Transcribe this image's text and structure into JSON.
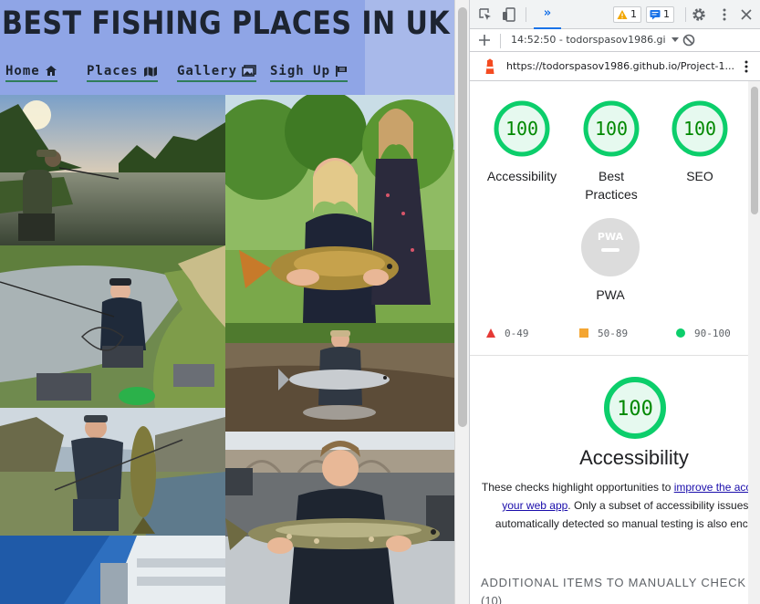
{
  "site": {
    "title": "BEST FISHING PLACES IN UK",
    "nav": [
      {
        "label": "Home",
        "icon": "home-icon"
      },
      {
        "label": "Places",
        "icon": "map-icon"
      },
      {
        "label": "Gallery",
        "icon": "images-icon"
      },
      {
        "label": "Sigh Up",
        "icon": "flag-icon"
      }
    ],
    "colors": {
      "hero": "#8fa5e6",
      "hero_right": "#a8b9ea",
      "nav_underline": "#2f7d5a",
      "title": "#1d2430"
    }
  },
  "devtools": {
    "toolbar": {
      "inspect_icon": "inspect-icon",
      "device_icon": "device-toggle-icon",
      "more_tabs": "»",
      "warnings_count": "1",
      "messages_count": "1",
      "settings_icon": "gear-icon",
      "menu_icon": "kebab-icon",
      "close_icon": "close-icon"
    },
    "report_bar": {
      "add_icon": "plus-icon",
      "report_select": "14:52:50 - todorspasov1986.gi",
      "clear_icon": "block-icon"
    },
    "url_bar": {
      "url": "https://todorspasov1986.github.io/Project-1...",
      "lighthouse_icon": "lighthouse-icon",
      "menu_icon": "kebab-icon"
    },
    "scores": [
      {
        "label": "Accessibility",
        "value": "100"
      },
      {
        "label": "Best Practices",
        "value": "100"
      },
      {
        "label": "SEO",
        "value": "100"
      }
    ],
    "pwa": {
      "label": "PWA",
      "badge": "PWA"
    },
    "legend": [
      {
        "range": "0-49",
        "color": "#e53935",
        "shape": "triangle"
      },
      {
        "range": "50-89",
        "color": "#f4a633",
        "shape": "square"
      },
      {
        "range": "90-100",
        "color": "#0cce6b",
        "shape": "circle"
      }
    ],
    "accessibility": {
      "score": "100",
      "title": "Accessibility",
      "desc_before": "These checks highlight opportunities to ",
      "desc_link": "improve the accessibility of your web app",
      "desc_after": ". Only a subset of accessibility issues can be automatically detected so manual testing is also encouraged.",
      "manual_heading": "ADDITIONAL ITEMS TO MANUALLY CHECK",
      "manual_count": "(10)"
    },
    "colors": {
      "pass": "#0cce6b",
      "pass_text": "#008800",
      "pass_fill": "#e6f9ef",
      "accent": "#1a73e8"
    }
  }
}
